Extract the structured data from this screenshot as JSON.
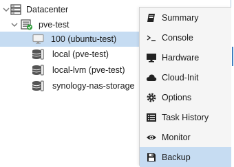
{
  "tree": {
    "datacenter": {
      "label": "Datacenter",
      "icon": "server-stack-icon"
    },
    "node": {
      "label": "pve-test",
      "icon": "node-online-icon",
      "status_color": "#2e9e3a"
    },
    "vm": {
      "label": "100 (ubuntu-test)",
      "icon": "monitor-icon"
    },
    "storages": [
      {
        "label": "local (pve-test)",
        "icon": "storage-icon"
      },
      {
        "label": "local-lvm (pve-test)",
        "icon": "storage-icon"
      },
      {
        "label": "synology-nas-storage",
        "icon": "storage-icon"
      }
    ]
  },
  "menu": {
    "items": [
      {
        "label": "Summary",
        "icon": "book-icon"
      },
      {
        "label": "Console",
        "icon": "terminal-icon"
      },
      {
        "label": "Hardware",
        "icon": "desktop-icon"
      },
      {
        "label": "Cloud-Init",
        "icon": "cloud-icon"
      },
      {
        "label": "Options",
        "icon": "gear-icon"
      },
      {
        "label": "Task History",
        "icon": "list-icon"
      },
      {
        "label": "Monitor",
        "icon": "eye-icon"
      },
      {
        "label": "Backup",
        "icon": "floppy-disk-icon"
      }
    ],
    "active_item": "Backup"
  },
  "colors": {
    "selection": "#c6dcf2",
    "menu_background": "#f5f5f5",
    "accent": "#3f7fbf"
  }
}
